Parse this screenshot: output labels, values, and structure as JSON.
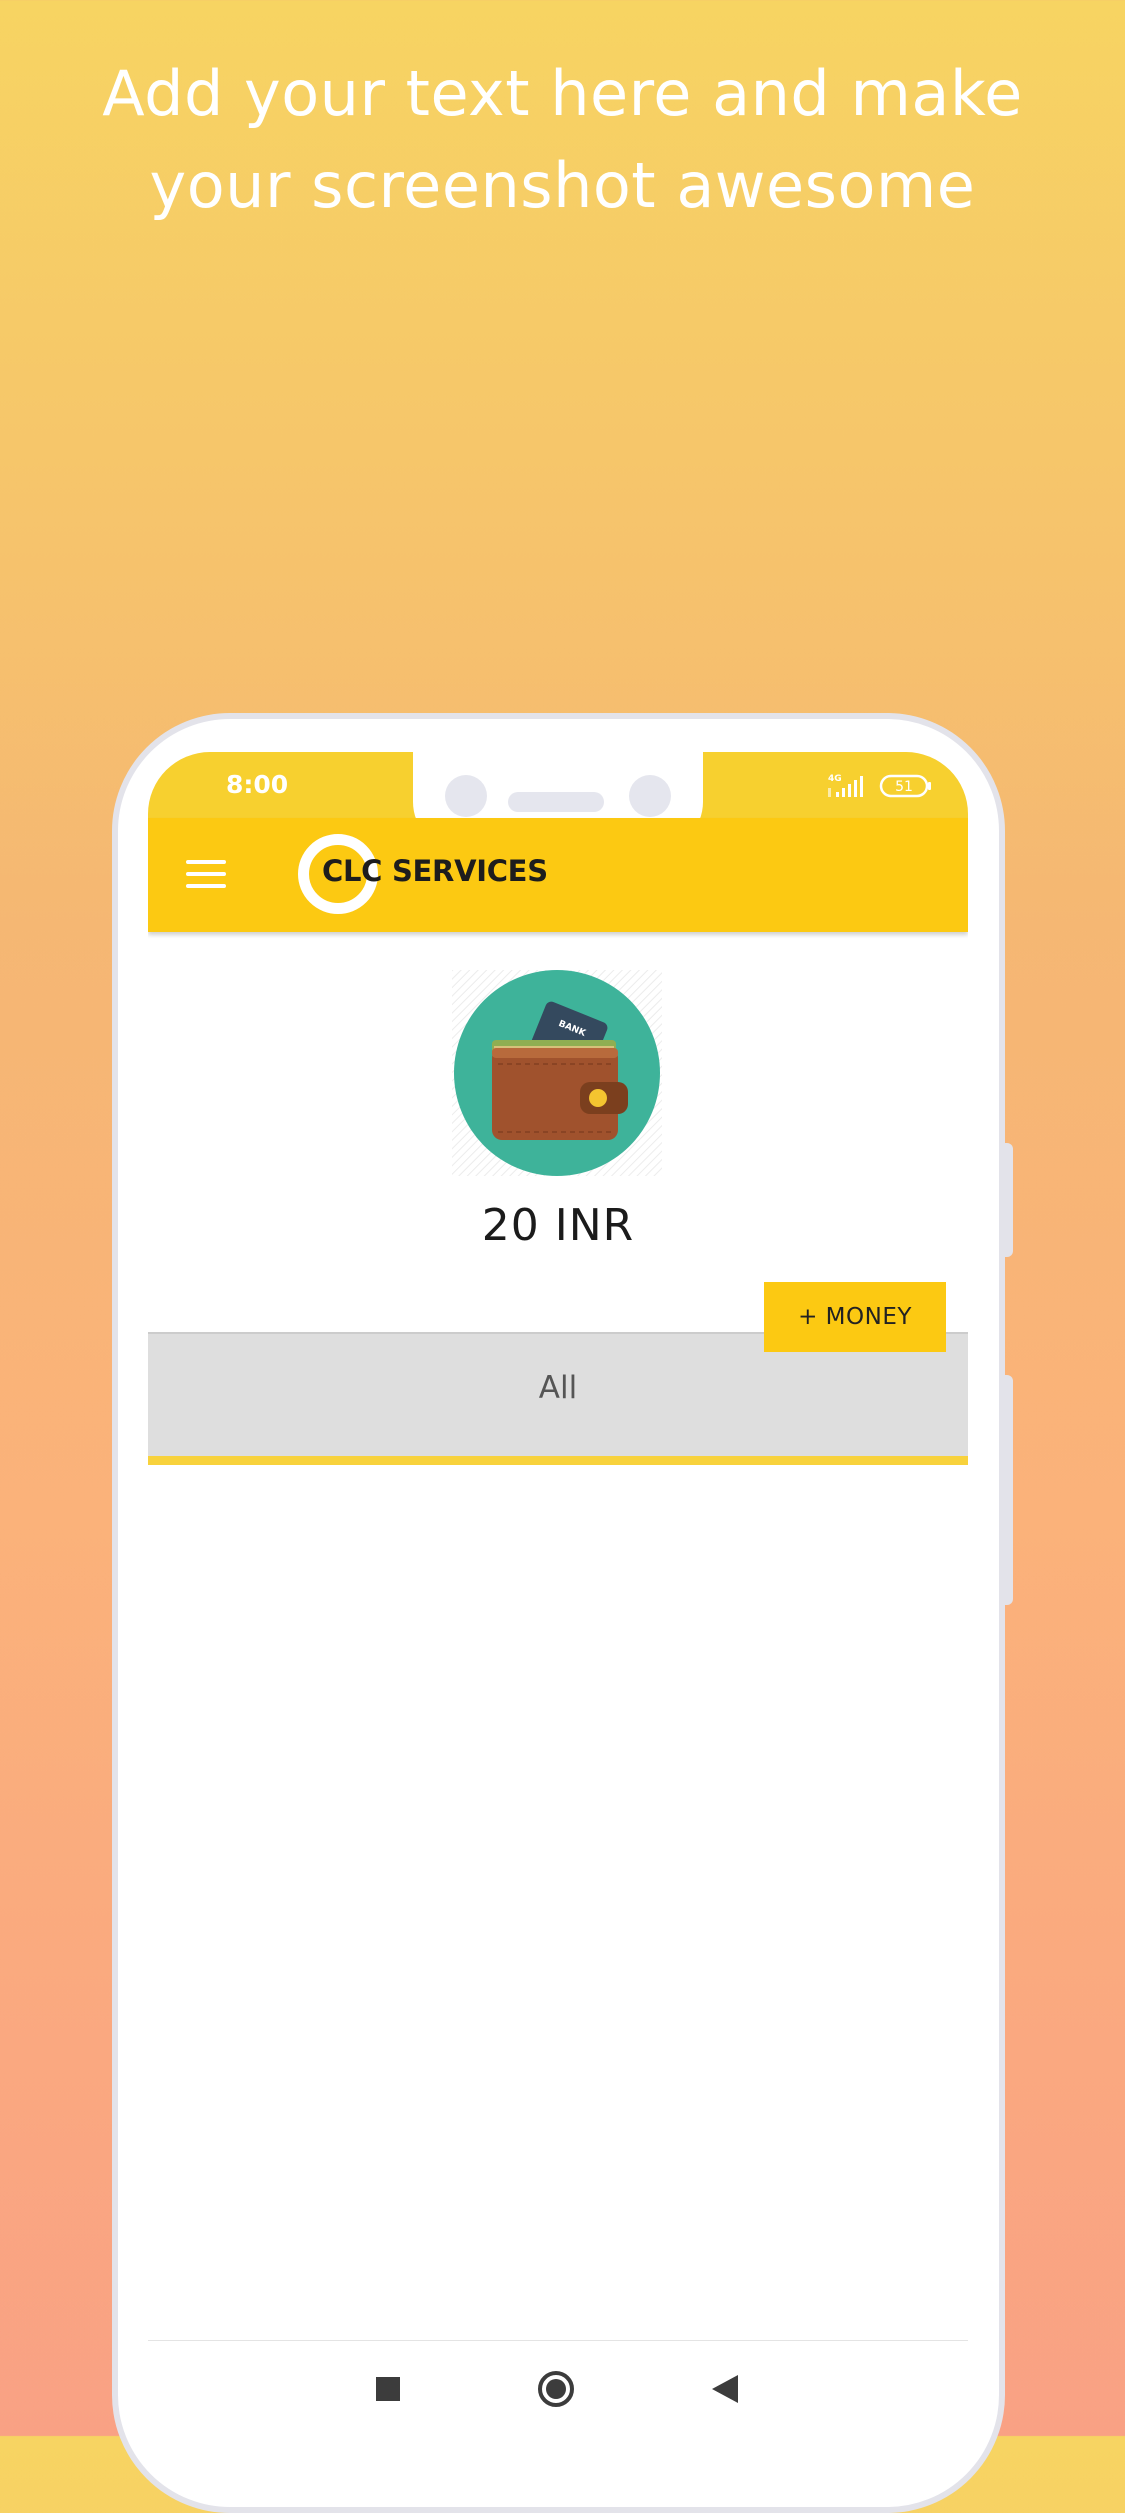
{
  "headline": {
    "line1": "Add your text here and make",
    "line2": "your screenshot awesome"
  },
  "status_bar": {
    "time": "8:00",
    "network": "4G",
    "battery": "51"
  },
  "app_bar": {
    "logo_text": "CLC SERVICES"
  },
  "wallet": {
    "card_label": "BANK",
    "balance": "20 INR",
    "add_money_label": "+ MONEY"
  },
  "tabs": [
    {
      "label": "All",
      "selected": true
    }
  ],
  "colors": {
    "accent_yellow": "#fcc912",
    "status_yellow": "#f7d02f",
    "wallet_circle": "#3eb39a",
    "tab_background": "#dedede"
  },
  "icons": {
    "menu": "hamburger-icon",
    "wallet": "wallet-icon",
    "nav_recent": "square-icon",
    "nav_home": "circle-icon",
    "nav_back": "triangle-back-icon"
  }
}
